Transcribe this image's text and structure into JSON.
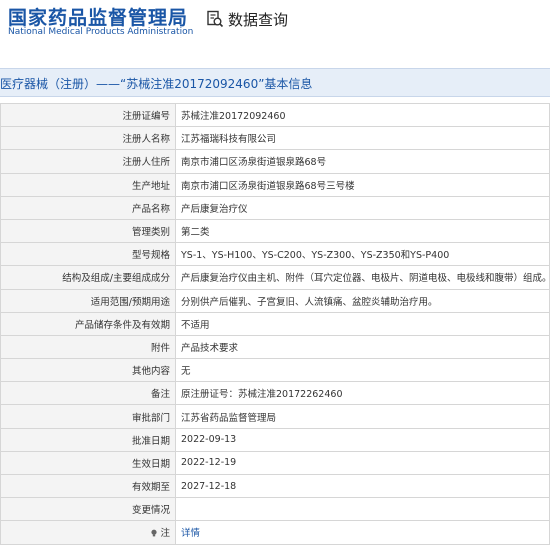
{
  "header": {
    "logo_cn": "国家药品监督管理局",
    "logo_en": "National Medical Products Administration",
    "search_title": "数据查询"
  },
  "title": "医疗器械（注册）——“苏械注准20172092460”基本信息",
  "rows": [
    {
      "label": "注册证编号",
      "value": "苏械注准20172092460"
    },
    {
      "label": "注册人名称",
      "value": "江苏福瑞科技有限公司"
    },
    {
      "label": "注册人住所",
      "value": "南京市浦口区汤泉街道银泉路68号"
    },
    {
      "label": "生产地址",
      "value": "南京市浦口区汤泉街道银泉路68号三号楼"
    },
    {
      "label": "产品名称",
      "value": "产后康复治疗仪"
    },
    {
      "label": "管理类别",
      "value": "第二类"
    },
    {
      "label": "型号规格",
      "value": "YS-1、YS-H100、YS-C200、YS-Z300、YS-Z350和YS-P400"
    },
    {
      "label": "结构及组成/主要组成成分",
      "value": "产后康复治疗仪由主机、附件（耳穴定位器、电极片、阴道电极、电极线和腹带）组成。"
    },
    {
      "label": "适用范围/预期用途",
      "value": "分别供产后催乳、子宫复旧、人流镇痛、盆腔炎辅助治疗用。"
    },
    {
      "label": "产品储存条件及有效期",
      "value": "不适用"
    },
    {
      "label": "附件",
      "value": "产品技术要求"
    },
    {
      "label": "其他内容",
      "value": "无"
    },
    {
      "label": "备注",
      "value": "原注册证号：苏械注准20172262460"
    },
    {
      "label": "审批部门",
      "value": "江苏省药品监督管理局"
    },
    {
      "label": "批准日期",
      "value": "2022-09-13"
    },
    {
      "label": "生效日期",
      "value": "2022-12-19"
    },
    {
      "label": "有效期至",
      "value": "2027-12-18"
    },
    {
      "label": "变更情况",
      "value": ""
    }
  ],
  "note_row": {
    "label": "注",
    "value": "详情",
    "icon": "bulb-icon"
  },
  "colors": {
    "brand": "#1a56a6",
    "title_bg": "#e6eef8",
    "label_bg": "#f4f4f4",
    "border": "#d6d6d6"
  }
}
